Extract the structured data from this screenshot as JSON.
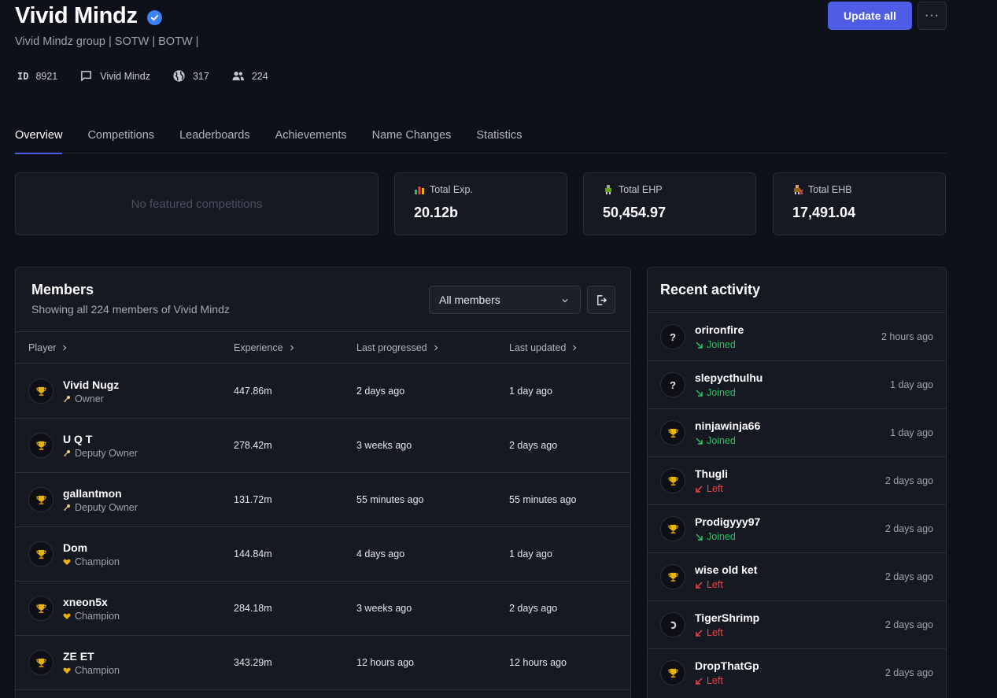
{
  "group": {
    "name": "Vivid Mindz",
    "description": "Vivid Mindz group | SOTW | BOTW |",
    "id_label": "ID",
    "id": "8921",
    "clan_chat": "Vivid Mindz",
    "world": "317",
    "member_count": "224"
  },
  "actions": {
    "update_all": "Update all",
    "more": "···"
  },
  "tabs": [
    "Overview",
    "Competitions",
    "Leaderboards",
    "Achievements",
    "Name Changes",
    "Statistics"
  ],
  "active_tab": "Overview",
  "featured": {
    "empty_text": "No featured competitions"
  },
  "metrics": [
    {
      "label": "Total Exp.",
      "value": "20.12b",
      "icon": "bar-chart-icon"
    },
    {
      "label": "Total EHP",
      "value": "50,454.97",
      "icon": "ehp-icon"
    },
    {
      "label": "Total EHB",
      "value": "17,491.04",
      "icon": "ehb-icon"
    }
  ],
  "members": {
    "title": "Members",
    "subtitle": "Showing all 224 members of Vivid Mindz",
    "filter": "All members",
    "columns": [
      "Player",
      "Experience",
      "Last progressed",
      "Last updated"
    ],
    "rows": [
      {
        "name": "Vivid Nugz",
        "role": "Owner",
        "role_icon": "key-icon",
        "experience": "447.86m",
        "last_progressed": "2 days ago",
        "last_updated": "1 day ago"
      },
      {
        "name": "U Q T",
        "role": "Deputy Owner",
        "role_icon": "key-icon",
        "experience": "278.42m",
        "last_progressed": "3 weeks ago",
        "last_updated": "2 days ago"
      },
      {
        "name": "gallantmon",
        "role": "Deputy Owner",
        "role_icon": "key-icon",
        "experience": "131.72m",
        "last_progressed": "55 minutes ago",
        "last_updated": "55 minutes ago"
      },
      {
        "name": "Dom",
        "role": "Champion",
        "role_icon": "heart-icon",
        "experience": "144.84m",
        "last_progressed": "4 days ago",
        "last_updated": "1 day ago"
      },
      {
        "name": "xneon5x",
        "role": "Champion",
        "role_icon": "heart-icon",
        "experience": "284.18m",
        "last_progressed": "3 weeks ago",
        "last_updated": "2 days ago"
      },
      {
        "name": "ZE ET",
        "role": "Champion",
        "role_icon": "heart-icon",
        "experience": "343.29m",
        "last_progressed": "12 hours ago",
        "last_updated": "12 hours ago"
      }
    ]
  },
  "activity": {
    "title": "Recent activity",
    "items": [
      {
        "name": "orironfire",
        "status": "Joined",
        "time": "2 hours ago",
        "avatar": "unknown-icon"
      },
      {
        "name": "slepycthulhu",
        "status": "Joined",
        "time": "1 day ago",
        "avatar": "unknown-icon"
      },
      {
        "name": "ninjawinja66",
        "status": "Joined",
        "time": "1 day ago",
        "avatar": "trophy-icon"
      },
      {
        "name": "Thugli",
        "status": "Left",
        "time": "2 days ago",
        "avatar": "trophy-icon"
      },
      {
        "name": "Prodigyyy97",
        "status": "Joined",
        "time": "2 days ago",
        "avatar": "trophy-icon"
      },
      {
        "name": "wise old ket",
        "status": "Left",
        "time": "2 days ago",
        "avatar": "trophy-icon"
      },
      {
        "name": "TigerShrimp",
        "status": "Left",
        "time": "2 days ago",
        "avatar": "shrimp-icon"
      },
      {
        "name": "DropThatGp",
        "status": "Left",
        "time": "2 days ago",
        "avatar": "trophy-icon"
      }
    ]
  }
}
